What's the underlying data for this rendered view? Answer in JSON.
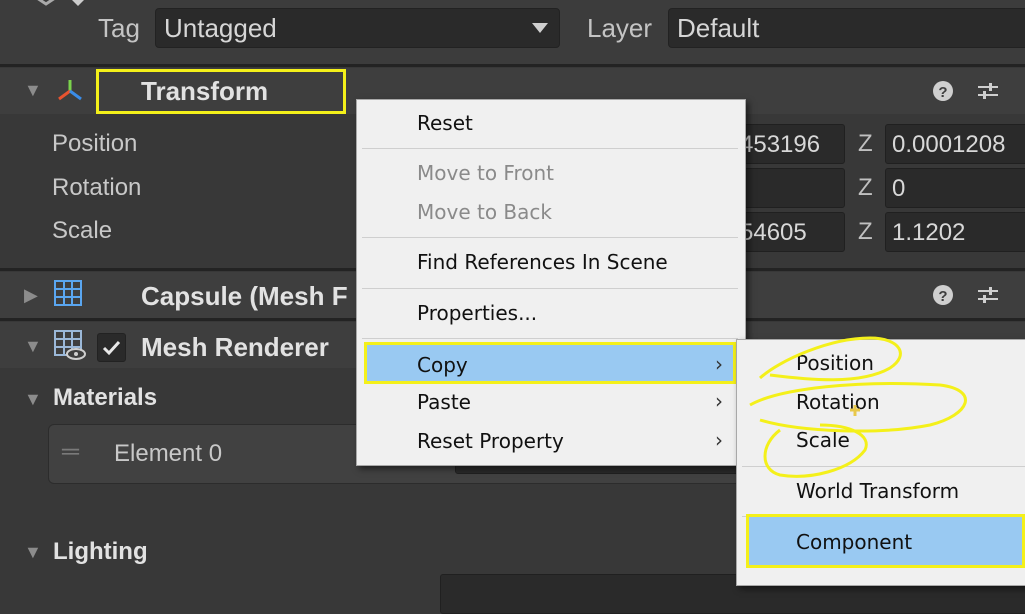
{
  "header": {
    "tag_label": "Tag",
    "tag_value": "Untagged",
    "layer_label": "Layer",
    "layer_value": "Default"
  },
  "transform": {
    "title": "Transform",
    "rows": [
      {
        "label": "Position",
        "y_partial": "453196",
        "z_label": "Z",
        "z_value": "0.0001208"
      },
      {
        "label": "Rotation",
        "y_partial": "",
        "z_label": "Z",
        "z_value": "0"
      },
      {
        "label": "Scale",
        "y_partial": "54605",
        "z_label": "Z",
        "z_value": "1.1202"
      }
    ]
  },
  "capsule": {
    "title": "Capsule (Mesh F"
  },
  "mesh_renderer": {
    "title": "Mesh Renderer"
  },
  "materials": {
    "title": "Materials",
    "element_label": "Element 0"
  },
  "lighting": {
    "title": "Lighting"
  },
  "context_menu": {
    "items": [
      {
        "label": "Reset"
      },
      {
        "label": "Move to Front"
      },
      {
        "label": "Move to Back"
      },
      {
        "label": "Find References In Scene"
      },
      {
        "label": "Properties..."
      },
      {
        "label": "Copy"
      },
      {
        "label": "Paste"
      },
      {
        "label": "Reset Property"
      }
    ]
  },
  "submenu": {
    "items": [
      {
        "label": "Position"
      },
      {
        "label": "Rotation"
      },
      {
        "label": "Scale"
      },
      {
        "label": "World Transform"
      },
      {
        "label": "Component"
      }
    ]
  },
  "colors": {
    "highlight": "#99c9f2",
    "annotation": "#f4f01a",
    "panel": "#383838"
  }
}
